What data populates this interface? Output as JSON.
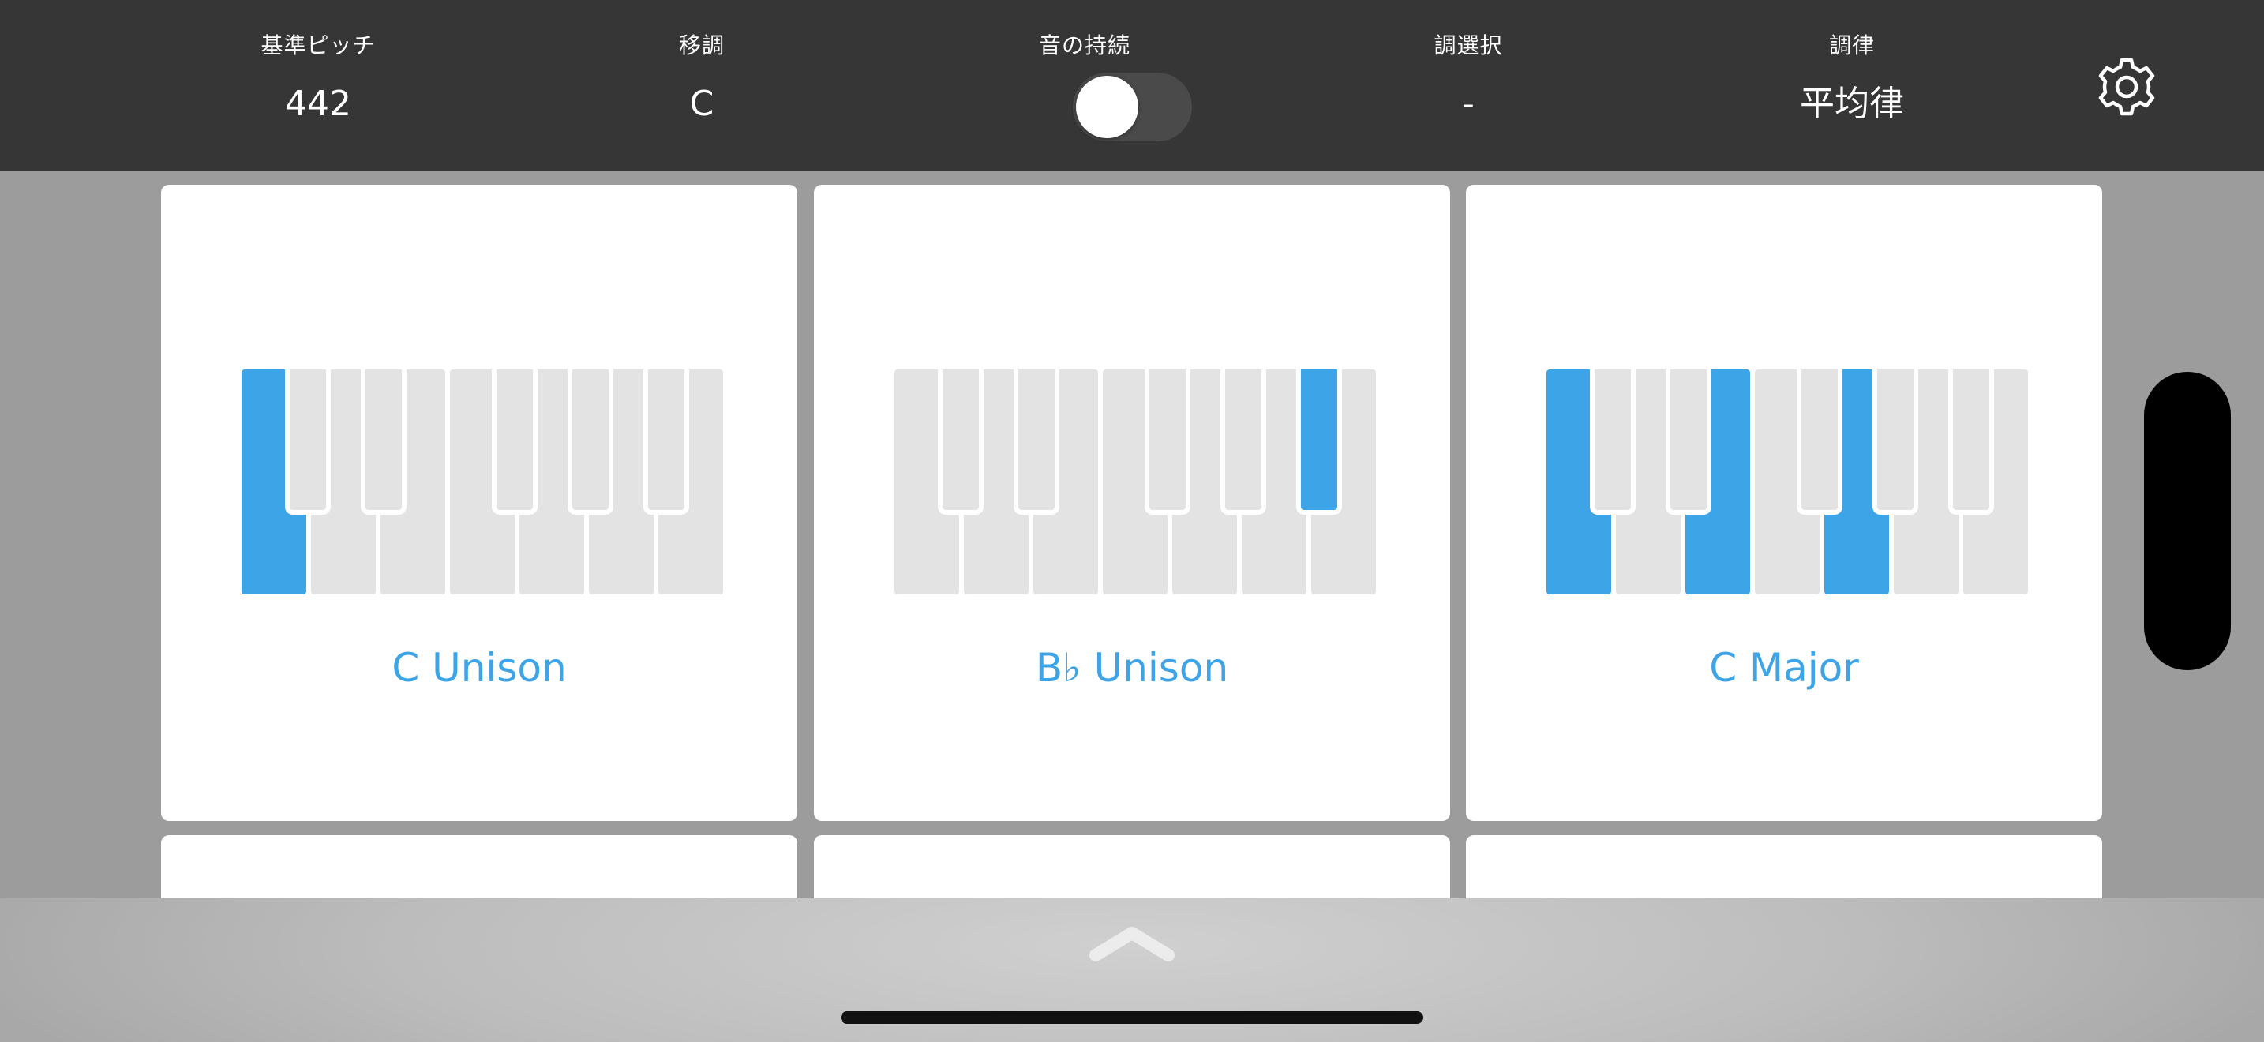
{
  "topbar": {
    "settings": [
      {
        "label": "基準ピッチ",
        "value": "442"
      },
      {
        "label": "移調",
        "value": "C"
      },
      {
        "label": "音の持続",
        "value": ""
      },
      {
        "label": "調選択",
        "value": "-"
      },
      {
        "label": "調律",
        "value": "平均律"
      }
    ],
    "sustain_on": false,
    "settings_icon": "gear-icon"
  },
  "cards": [
    {
      "title": "C Unison",
      "active_keys": [
        "C"
      ]
    },
    {
      "title": "B♭ Unison",
      "active_keys": [
        "Bb"
      ]
    },
    {
      "title": "C Major",
      "active_keys": [
        "C",
        "E",
        "G"
      ]
    }
  ],
  "drawer": {
    "icon": "chevron-up-icon"
  },
  "colors": {
    "accent": "#3ea4e8",
    "topbar": "#363636",
    "background": "#9c9c9c",
    "key_inactive": "#e3e3e3"
  }
}
